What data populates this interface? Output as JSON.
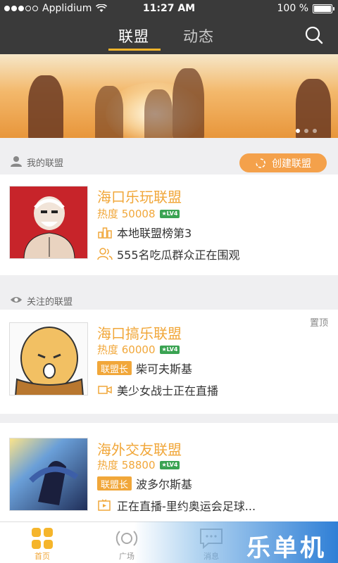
{
  "status": {
    "carrier": "Applidium",
    "time": "11:27 AM",
    "battery": "100 %"
  },
  "tabs": [
    {
      "label": "联盟"
    },
    {
      "label": "动态"
    }
  ],
  "my_section": {
    "label": "我的联盟",
    "create_button": "创建联盟"
  },
  "my_league": {
    "name": "海口乐玩联盟",
    "heat": "热度 50008",
    "level": "LV4",
    "rank": "本地联盟榜第3",
    "watchers": "555名吃瓜群众正在围观"
  },
  "follow_section": {
    "label": "关注的联盟"
  },
  "followed": [
    {
      "name": "海口搞乐联盟",
      "heat": "热度 60000",
      "level": "LV4",
      "role": "联盟长",
      "leader": "柴可夫斯基",
      "live": "美少女战士正在直播",
      "pin": "置顶"
    },
    {
      "name": "海外交友联盟",
      "heat": "热度 58800",
      "level": "LV4",
      "role": "联盟长",
      "leader": "波多尔斯基",
      "live": "正在直播-里约奥运会足球..."
    }
  ],
  "bottom_nav": [
    {
      "label": "首页"
    },
    {
      "label": "广场"
    },
    {
      "label": "消息"
    }
  ],
  "watermark": "乐单机",
  "colors": {
    "accent": "#f1a73a",
    "topbar": "#3a3a3a",
    "create_button": "#f4a14b"
  }
}
